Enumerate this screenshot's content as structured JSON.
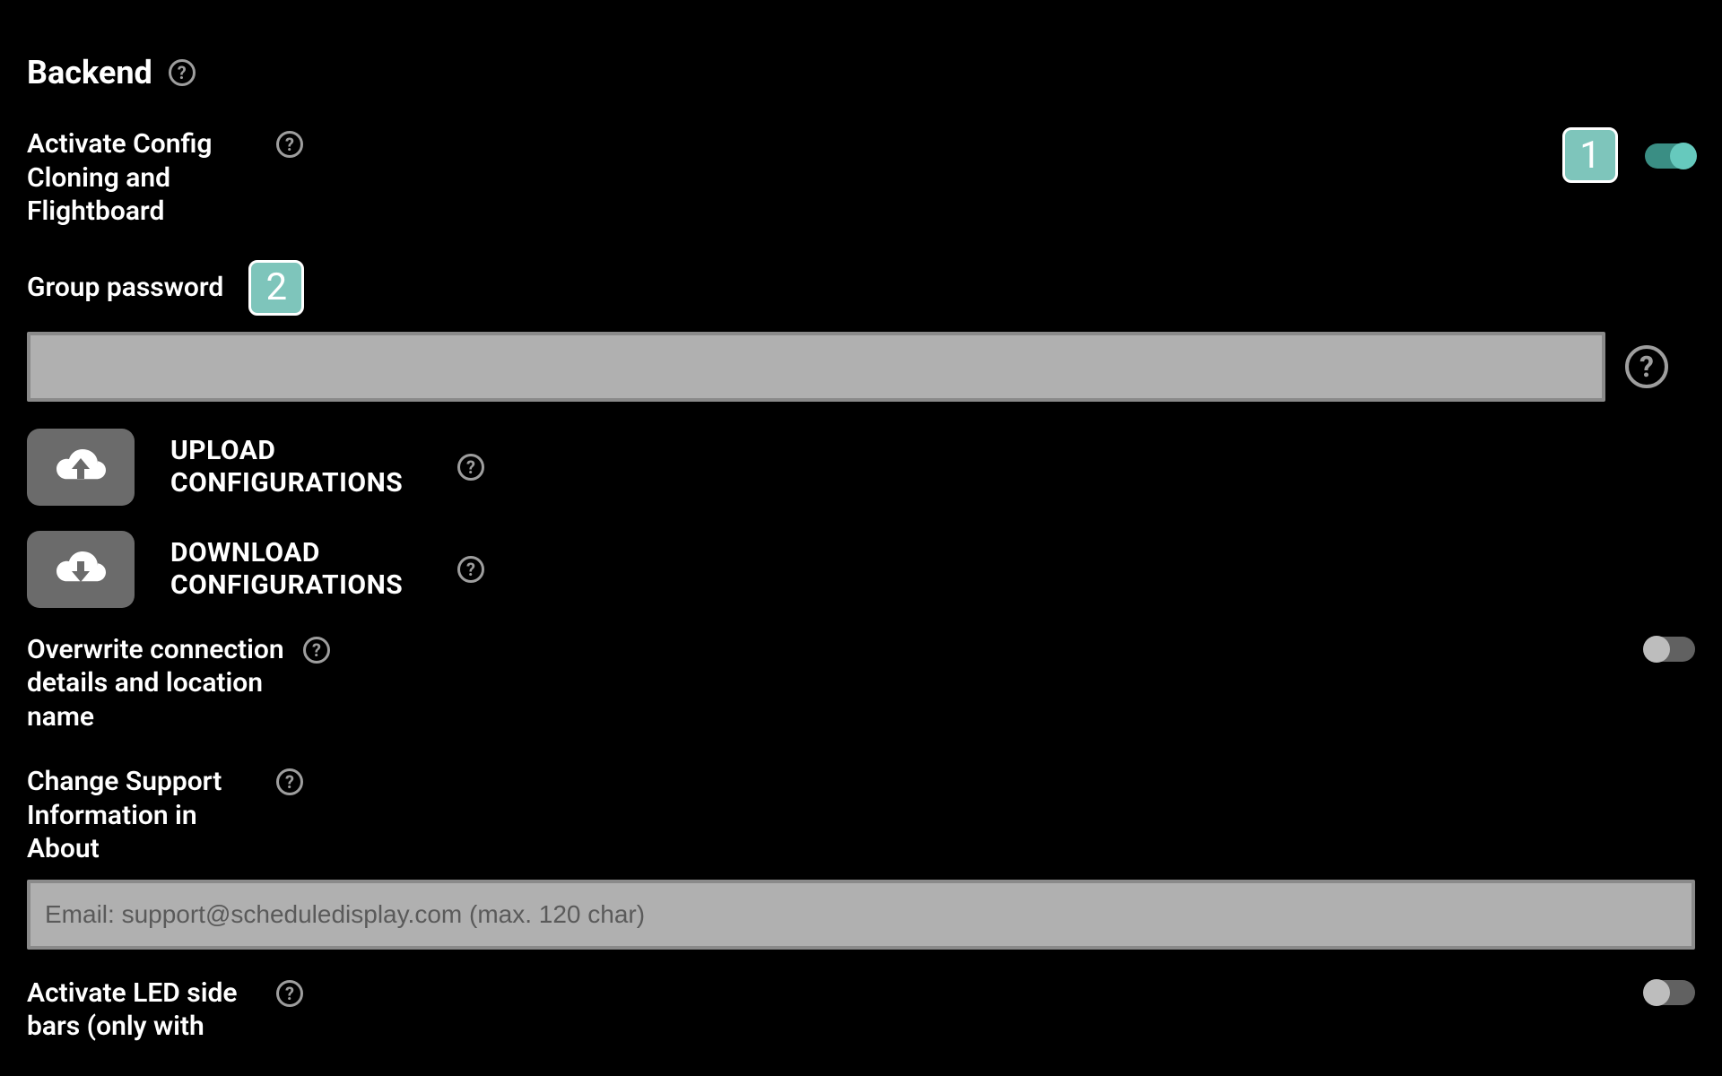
{
  "section": {
    "title": "Backend"
  },
  "settings": {
    "activate_cloning": {
      "label": "Activate Config Cloning and Flightboard",
      "badge": "1",
      "toggle_on": true
    },
    "group_password": {
      "label": "Group password",
      "badge": "2",
      "value": ""
    },
    "upload": {
      "label": "UPLOAD CONFIGURATIONS"
    },
    "download": {
      "label": "DOWNLOAD CONFIGURATIONS"
    },
    "overwrite": {
      "label": "Overwrite connection details and location name",
      "toggle_on": false
    },
    "support_info": {
      "label": "Change Support Information in About",
      "placeholder": "Email: support@scheduledisplay.com (max. 120 char)",
      "value": ""
    },
    "led_bars": {
      "label": "Activate LED side bars (only with",
      "toggle_on": false
    }
  }
}
